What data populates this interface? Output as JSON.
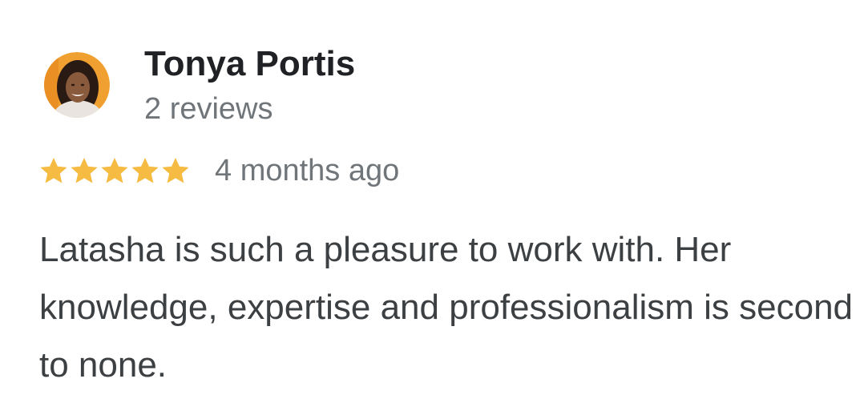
{
  "review": {
    "reviewer_name": "Tonya Portis",
    "review_count": "2 reviews",
    "rating": 5,
    "rating_max": 5,
    "time_ago": "4 months ago",
    "text": "Latasha is such a pleasure to work with. Her knowledge, expertise and professionalism is second to none."
  },
  "icons": {
    "avatar": "reviewer-avatar",
    "star": "star-icon"
  },
  "colors": {
    "star": "#f6bb42",
    "name": "#202124",
    "secondary_text": "#70757a",
    "body_text": "#3c4043",
    "avatar_background": "#f0a030"
  }
}
